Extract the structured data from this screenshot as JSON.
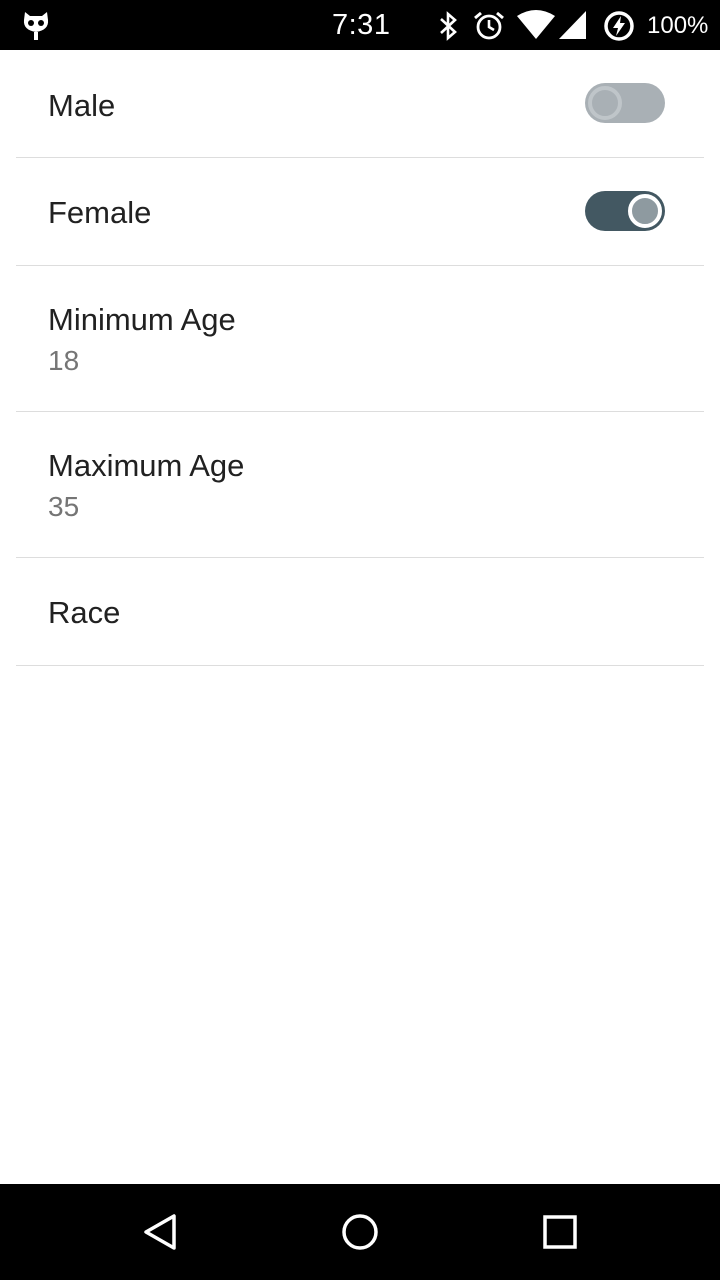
{
  "status_bar": {
    "time": "7:31",
    "battery_percent": "100%",
    "icons": [
      "cyanogen-bot-icon",
      "bluetooth-icon",
      "alarm-icon",
      "wifi-icon",
      "cell-signal-icon",
      "battery-charging-icon"
    ]
  },
  "settings": [
    {
      "title": "Male",
      "switch_on": false
    },
    {
      "title": "Female",
      "switch_on": true
    },
    {
      "title": "Minimum Age",
      "summary": "18"
    },
    {
      "title": "Maximum Age",
      "summary": "35"
    },
    {
      "title": "Race"
    }
  ],
  "navigation": {
    "icons": [
      "back-icon",
      "home-icon",
      "recents-icon"
    ]
  },
  "colors": {
    "switch_on_track": "#435862",
    "switch_off_track": "#a9b0b5",
    "title_text": "#212121",
    "summary_text": "#757575"
  }
}
